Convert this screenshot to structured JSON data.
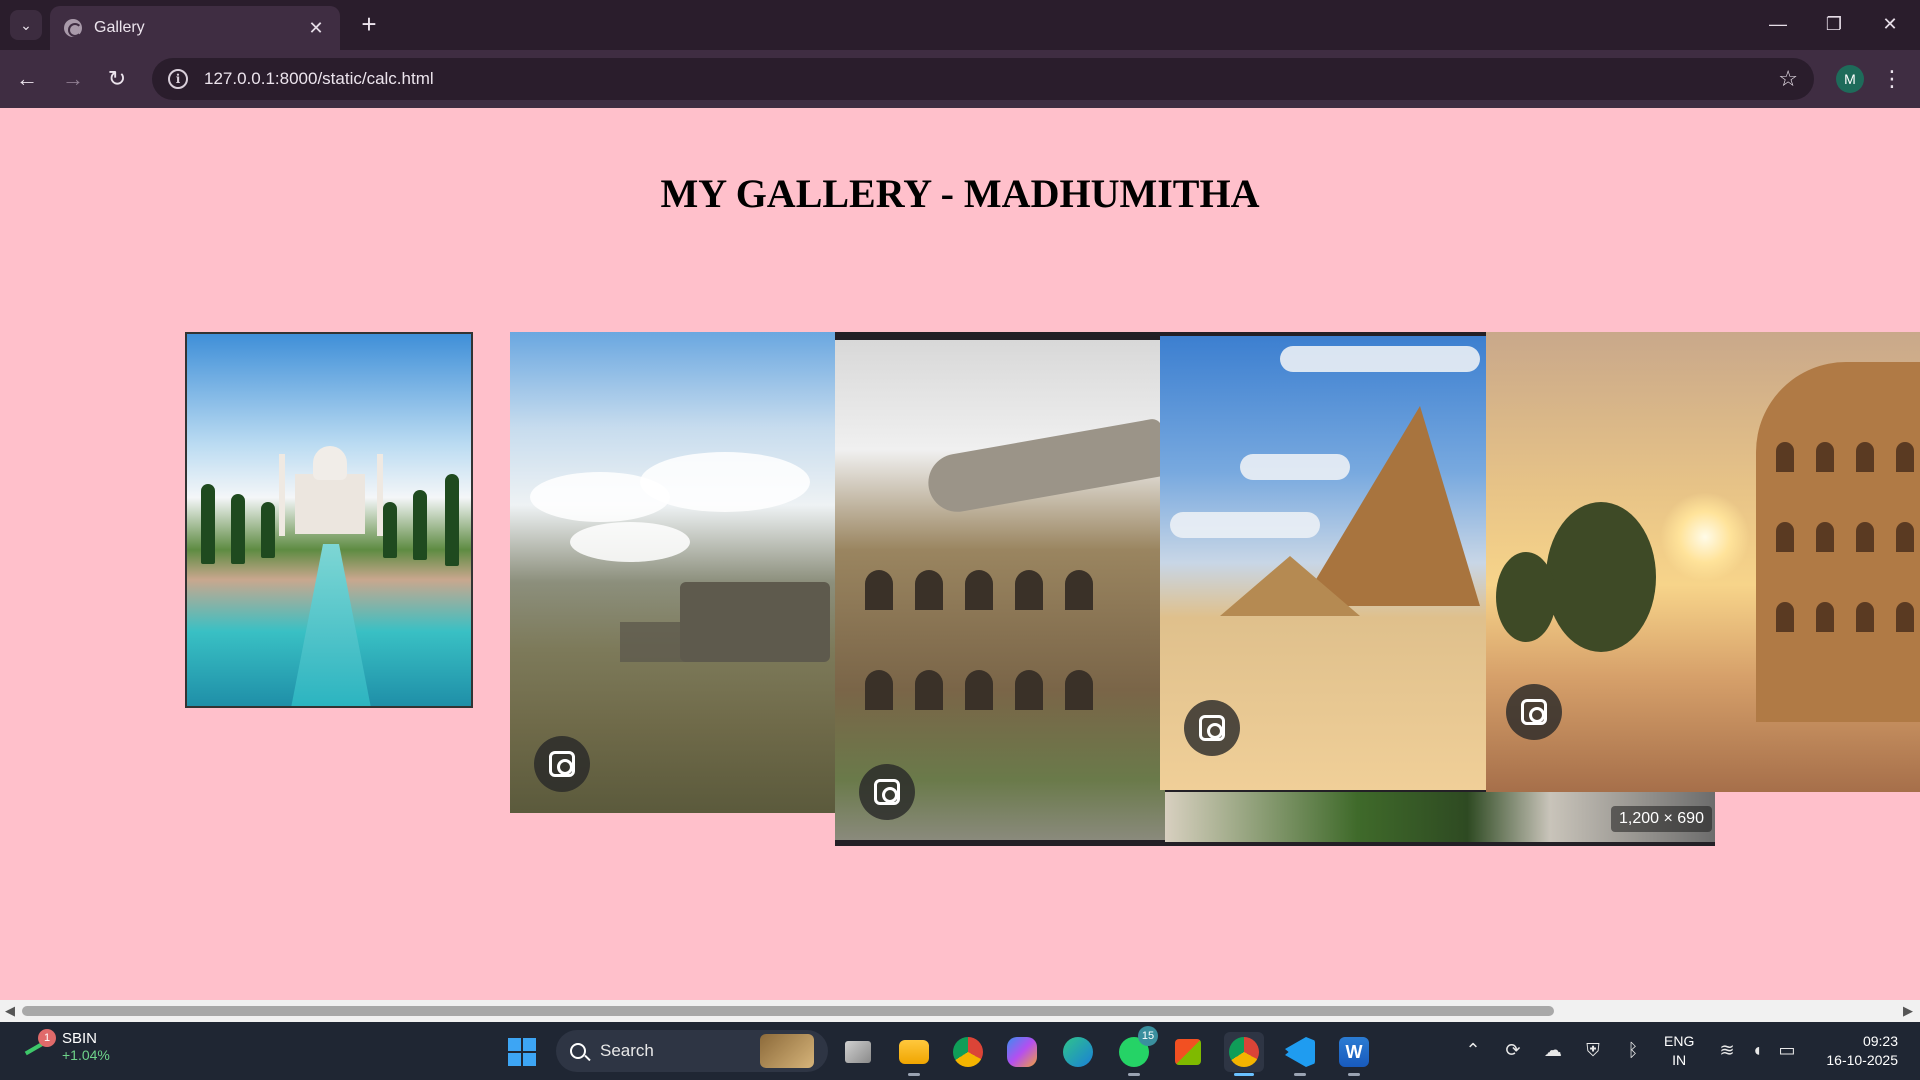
{
  "browser": {
    "tab_title": "Gallery",
    "tab_close": "✕",
    "new_tab": "+",
    "url": "127.0.0.1:8000/static/calc.html",
    "profile_initial": "M",
    "window_controls": {
      "minimize": "—",
      "restore": "❐",
      "close": "✕"
    }
  },
  "page": {
    "heading": "MY GALLERY - MADHUMITHA",
    "background": "#ffc0cb",
    "images": [
      {
        "subject": "Taj Mahal"
      },
      {
        "subject": "Machu Picchu"
      },
      {
        "subject": "Colosseum and Christ the Redeemer",
        "size_badge": "1,200 × 690"
      },
      {
        "subject": "Pyramids of Giza"
      },
      {
        "subject": "Colosseum at sunset"
      }
    ]
  },
  "taskbar": {
    "stock": {
      "symbol": "SBIN",
      "change": "+1.04%",
      "badge": "1"
    },
    "search_label": "Search",
    "whatsapp_badge": "15",
    "language": {
      "line1": "ENG",
      "line2": "IN"
    },
    "time": "09:23",
    "date": "16-10-2025"
  },
  "colors": {
    "chrome_dark": "#2a1d2c",
    "chrome_toolbar": "#3f2d42",
    "taskbar": "#1f2633",
    "accent_blue": "#3da5f4"
  }
}
